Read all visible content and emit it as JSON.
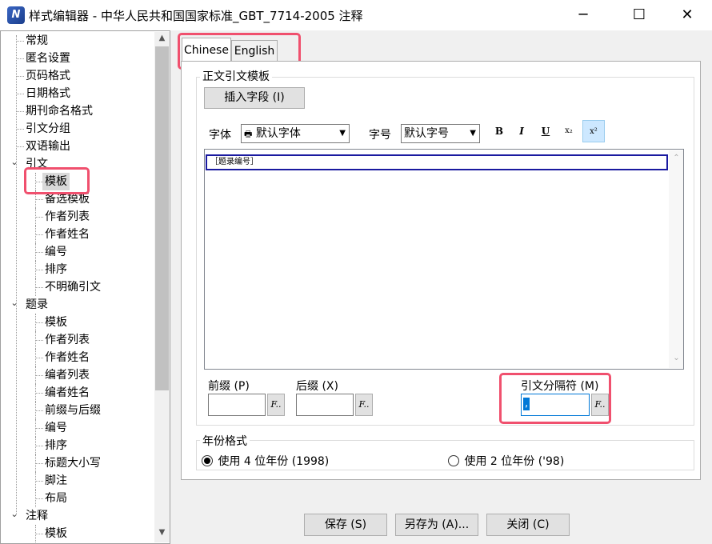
{
  "window": {
    "title": "样式编辑器 - 中华人民共和国国家标准_GBT_7714-2005 注释",
    "icon": "app-logo-icon",
    "controls": {
      "minimize": "─",
      "maximize": "☐",
      "close": "✕"
    }
  },
  "tree": {
    "items": [
      {
        "label": "常规",
        "level": 1
      },
      {
        "label": "匿名设置",
        "level": 1
      },
      {
        "label": "页码格式",
        "level": 1
      },
      {
        "label": "日期格式",
        "level": 1
      },
      {
        "label": "期刊命名格式",
        "level": 1
      },
      {
        "label": "引文分组",
        "level": 1
      },
      {
        "label": "双语输出",
        "level": 1
      },
      {
        "label": "引文",
        "level": 1,
        "expanded": true
      },
      {
        "label": "模板",
        "level": 2,
        "selected": true
      },
      {
        "label": "备选模板",
        "level": 2
      },
      {
        "label": "作者列表",
        "level": 2
      },
      {
        "label": "作者姓名",
        "level": 2
      },
      {
        "label": "编号",
        "level": 2
      },
      {
        "label": "排序",
        "level": 2
      },
      {
        "label": "不明确引文",
        "level": 2
      },
      {
        "label": "题录",
        "level": 1,
        "expanded": true
      },
      {
        "label": "模板",
        "level": 2
      },
      {
        "label": "作者列表",
        "level": 2
      },
      {
        "label": "作者姓名",
        "level": 2
      },
      {
        "label": "编者列表",
        "level": 2
      },
      {
        "label": "编者姓名",
        "level": 2
      },
      {
        "label": "前缀与后缀",
        "level": 2
      },
      {
        "label": "编号",
        "level": 2
      },
      {
        "label": "排序",
        "level": 2
      },
      {
        "label": "标题大小写",
        "level": 2
      },
      {
        "label": "脚注",
        "level": 2
      },
      {
        "label": "布局",
        "level": 2
      },
      {
        "label": "注释",
        "level": 1,
        "expanded": true
      },
      {
        "label": "模板",
        "level": 2
      }
    ]
  },
  "tabs": [
    {
      "label": "Chinese",
      "active": true
    },
    {
      "label": "English",
      "active": false
    }
  ],
  "template_group": {
    "legend": "正文引文模板",
    "insert_field_button": "插入字段 (I)",
    "font_label": "字体",
    "font_value": "默认字体",
    "size_label": "字号",
    "size_value": "默认字号",
    "format_buttons": {
      "bold": "B",
      "italic": "I",
      "underline": "U",
      "subscript": "x₂",
      "superscript": "x²"
    },
    "editor_content": "［题录编号］"
  },
  "affixes": {
    "prefix_label": "前缀 (P)",
    "suffix_label": "后缀 (X)",
    "separator_label": "引文分隔符 (M)",
    "separator_value": ",",
    "f_button": "F.."
  },
  "year_group": {
    "legend": "年份格式",
    "option_4": "使用 4 位年份 (1998)",
    "option_2": "使用 2 位年份 ('98)",
    "selected": "option_4"
  },
  "footer": {
    "save": "保存 (S)",
    "save_as": "另存为 (A)...",
    "close": "关闭 (C)"
  },
  "colors": {
    "highlight": "#f0506e",
    "selection": "#d9d9d9",
    "editor_focus": "#1a1aa0"
  }
}
